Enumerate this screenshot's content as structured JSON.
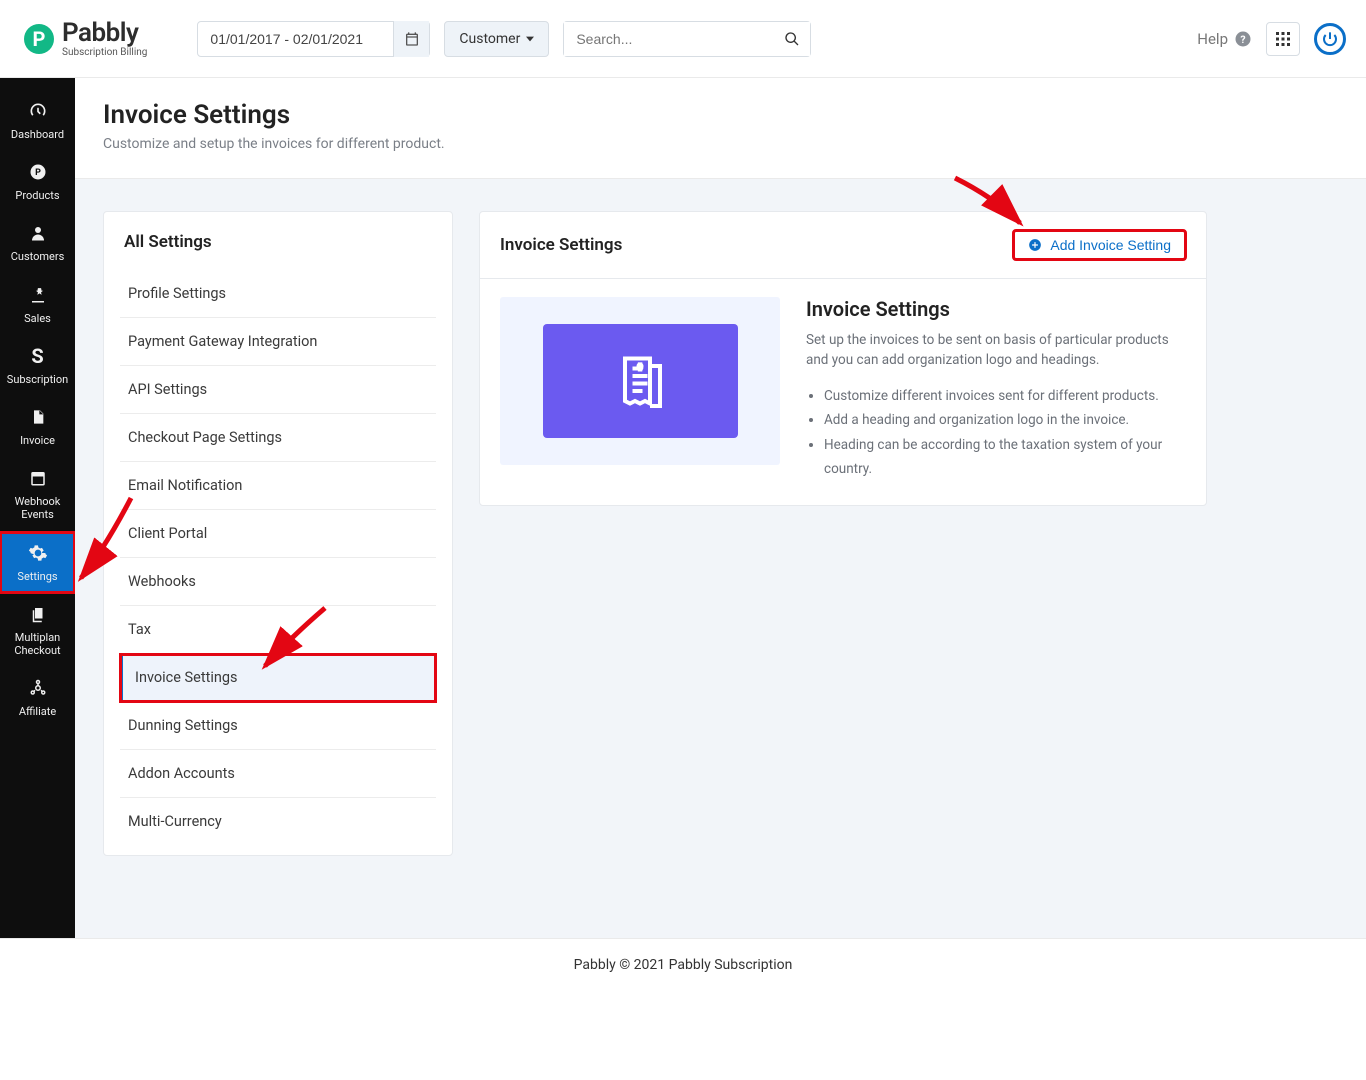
{
  "brand": {
    "name": "Pabbly",
    "tagline": "Subscription Billing"
  },
  "header": {
    "date_range": "01/01/2017 - 02/01/2021",
    "filter_label": "Customer",
    "search_placeholder": "Search...",
    "help_label": "Help"
  },
  "sidebar": {
    "items": [
      {
        "label": "Dashboard"
      },
      {
        "label": "Products"
      },
      {
        "label": "Customers"
      },
      {
        "label": "Sales"
      },
      {
        "label": "Subscription"
      },
      {
        "label": "Invoice"
      },
      {
        "label": "Webhook Events"
      },
      {
        "label": "Settings"
      },
      {
        "label": "Multiplan Checkout"
      },
      {
        "label": "Affiliate"
      }
    ]
  },
  "page": {
    "title": "Invoice Settings",
    "subtitle": "Customize and setup the invoices for different product."
  },
  "settings_panel": {
    "title": "All Settings",
    "items": [
      "Profile Settings",
      "Payment Gateway Integration",
      "API Settings",
      "Checkout Page Settings",
      "Email Notification",
      "Client Portal",
      "Webhooks",
      "Tax",
      "Invoice Settings",
      "Dunning Settings",
      "Addon Accounts",
      "Multi-Currency"
    ]
  },
  "main_panel": {
    "title": "Invoice Settings",
    "add_label": "Add Invoice Setting",
    "section_title": "Invoice Settings",
    "description": "Set up the invoices to be sent on basis of particular products and you can add organization logo and headings.",
    "bullets": [
      "Customize different invoices sent for different products.",
      "Add a heading and organization logo in the invoice.",
      "Heading can be according to the taxation system of your country."
    ]
  },
  "footer": "Pabbly © 2021 Pabbly Subscription"
}
